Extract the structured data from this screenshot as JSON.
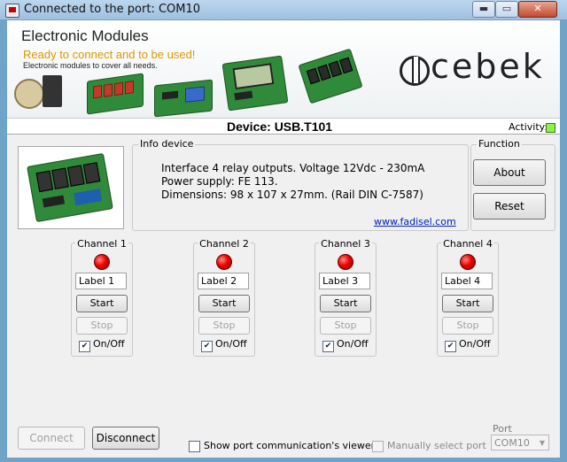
{
  "window": {
    "title": "Connected to the port: COM10",
    "min_glyph": "▬",
    "max_glyph": "▭",
    "close_glyph": "✕"
  },
  "banner": {
    "title": "Electronic Modules",
    "subtitle": "Ready to connect and to be used!",
    "description": "Electronic modules to cover all needs.",
    "logo_text": "cebek"
  },
  "device": {
    "label": "Device: USB.T101",
    "activity_label": "Activity:",
    "activity_color": "#8ef04a"
  },
  "info": {
    "group_title": "Info device",
    "lines": [
      "Interface 4 relay outputs.   Voltage 12Vdc - 230mA",
      "Power supply: FE 113.",
      "Dimensions: 98 x 107 x 27mm. (Rail DIN C-7587)"
    ],
    "link": "www.fadisel.com"
  },
  "function": {
    "group_title": "Function",
    "about_label": "About",
    "reset_label": "Reset"
  },
  "channels": [
    {
      "title": "Channel 1",
      "label_value": "Label 1",
      "start": "Start",
      "stop": "Stop",
      "onoff": "On/Off",
      "checked": true
    },
    {
      "title": "Channel 2",
      "label_value": "Label 2",
      "start": "Start",
      "stop": "Stop",
      "onoff": "On/Off",
      "checked": true
    },
    {
      "title": "Channel 3",
      "label_value": "Label 3",
      "start": "Start",
      "stop": "Stop",
      "onoff": "On/Off",
      "checked": true
    },
    {
      "title": "Channel 4",
      "label_value": "Label 4",
      "start": "Start",
      "stop": "Stop",
      "onoff": "On/Off",
      "checked": true
    }
  ],
  "footer": {
    "connect_label": "Connect",
    "disconnect_label": "Disconnect",
    "viewer_label": "Show port communication's viewer",
    "manual_label": "Manually select port",
    "port_label": "Port",
    "port_value": "COM10"
  },
  "colors": {
    "led_off": "#e00000",
    "link": "#0020c0"
  }
}
